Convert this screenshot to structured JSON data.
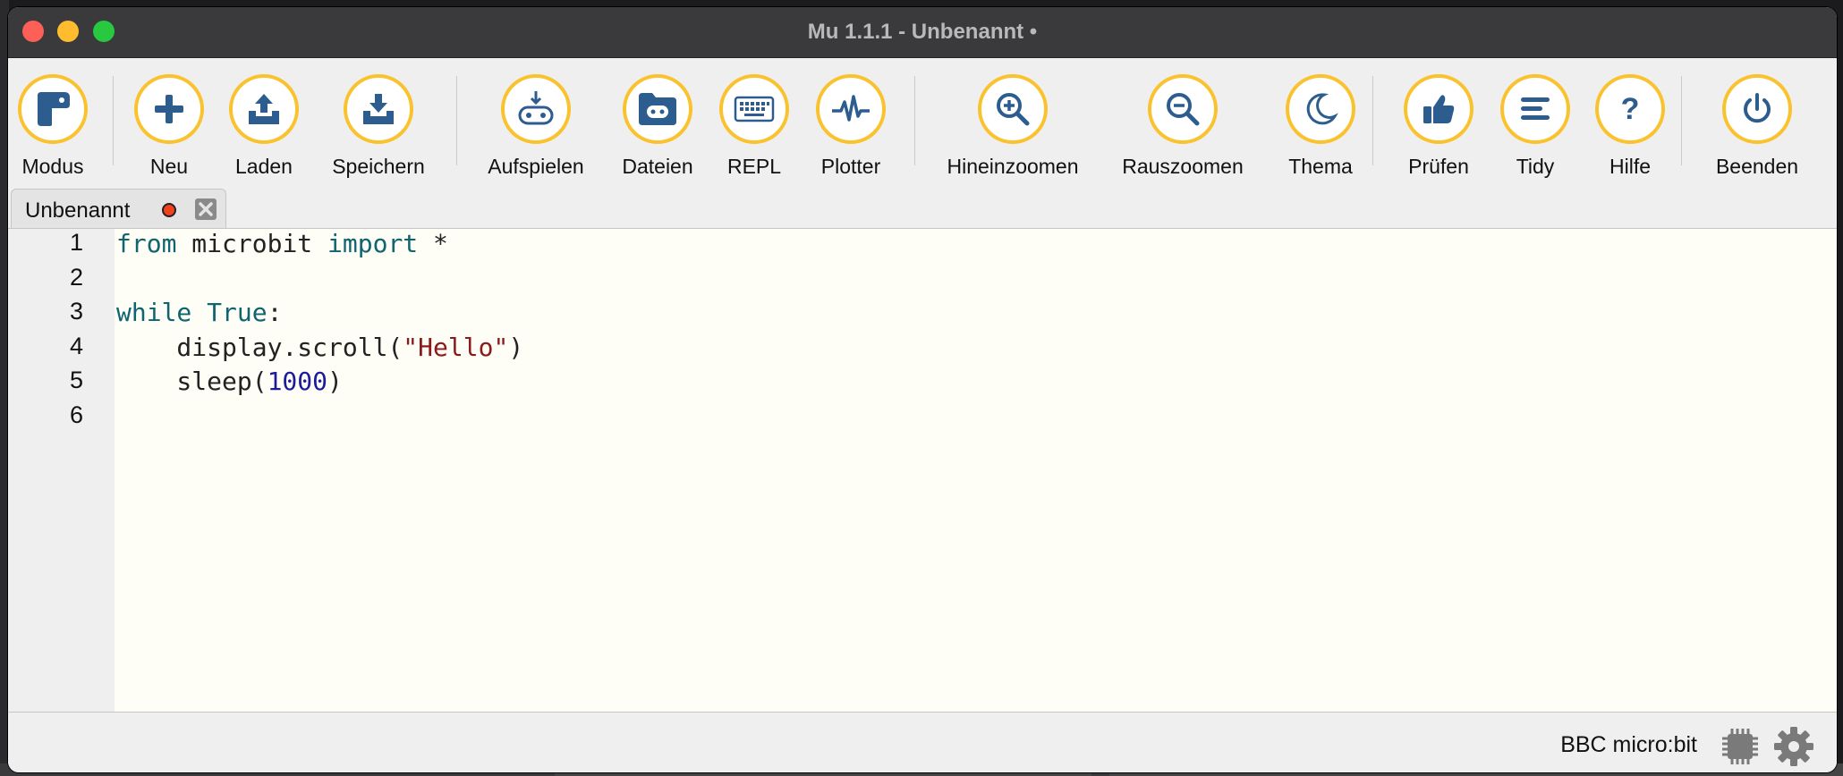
{
  "window": {
    "title": "Mu 1.1.1 - Unbenannt •"
  },
  "toolbar": {
    "buttons": [
      {
        "id": "modus",
        "label": "Modus",
        "icon": "mode-icon"
      },
      {
        "id": "neu",
        "label": "Neu",
        "icon": "plus-icon"
      },
      {
        "id": "laden",
        "label": "Laden",
        "icon": "upload-icon"
      },
      {
        "id": "speichern",
        "label": "Speichern",
        "icon": "download-icon"
      },
      {
        "id": "aufspielen",
        "label": "Aufspielen",
        "icon": "flash-icon"
      },
      {
        "id": "dateien",
        "label": "Dateien",
        "icon": "files-icon"
      },
      {
        "id": "repl",
        "label": "REPL",
        "icon": "keyboard-icon"
      },
      {
        "id": "plotter",
        "label": "Plotter",
        "icon": "pulse-icon"
      },
      {
        "id": "hineinzoomen",
        "label": "Hineinzoomen",
        "icon": "zoom-in-icon"
      },
      {
        "id": "rauszoomen",
        "label": "Rauszoomen",
        "icon": "zoom-out-icon"
      },
      {
        "id": "thema",
        "label": "Thema",
        "icon": "moon-icon"
      },
      {
        "id": "pruefen",
        "label": "Prüfen",
        "icon": "thumbs-up-icon"
      },
      {
        "id": "tidy",
        "label": "Tidy",
        "icon": "lines-icon"
      },
      {
        "id": "hilfe",
        "label": "Hilfe",
        "icon": "help-icon"
      },
      {
        "id": "beenden",
        "label": "Beenden",
        "icon": "power-icon"
      }
    ]
  },
  "tabs": [
    {
      "label": "Unbenannt",
      "modified": true
    }
  ],
  "editor": {
    "line_numbers": [
      "1",
      "2",
      "3",
      "4",
      "5",
      "6"
    ],
    "lines": [
      [
        {
          "t": "from",
          "c": "kw"
        },
        {
          "t": " microbit ",
          "c": ""
        },
        {
          "t": "import",
          "c": "kw"
        },
        {
          "t": " *",
          "c": ""
        }
      ],
      [],
      [
        {
          "t": "while",
          "c": "kw"
        },
        {
          "t": " ",
          "c": ""
        },
        {
          "t": "True",
          "c": "kw"
        },
        {
          "t": ":",
          "c": ""
        }
      ],
      [
        {
          "t": "    display.scroll(",
          "c": ""
        },
        {
          "t": "\"Hello\"",
          "c": "str"
        },
        {
          "t": ")",
          "c": ""
        }
      ],
      [
        {
          "t": "    sleep(",
          "c": ""
        },
        {
          "t": "1000",
          "c": "num"
        },
        {
          "t": ")",
          "c": ""
        }
      ],
      []
    ]
  },
  "status": {
    "mode": "BBC micro:bit"
  },
  "colors": {
    "accent": "#f9c22e",
    "icon": "#2d5d8e",
    "keyword": "#0e6470",
    "string": "#8b1a1a",
    "number": "#1c1c9a",
    "editor_bg": "#fefef6"
  }
}
